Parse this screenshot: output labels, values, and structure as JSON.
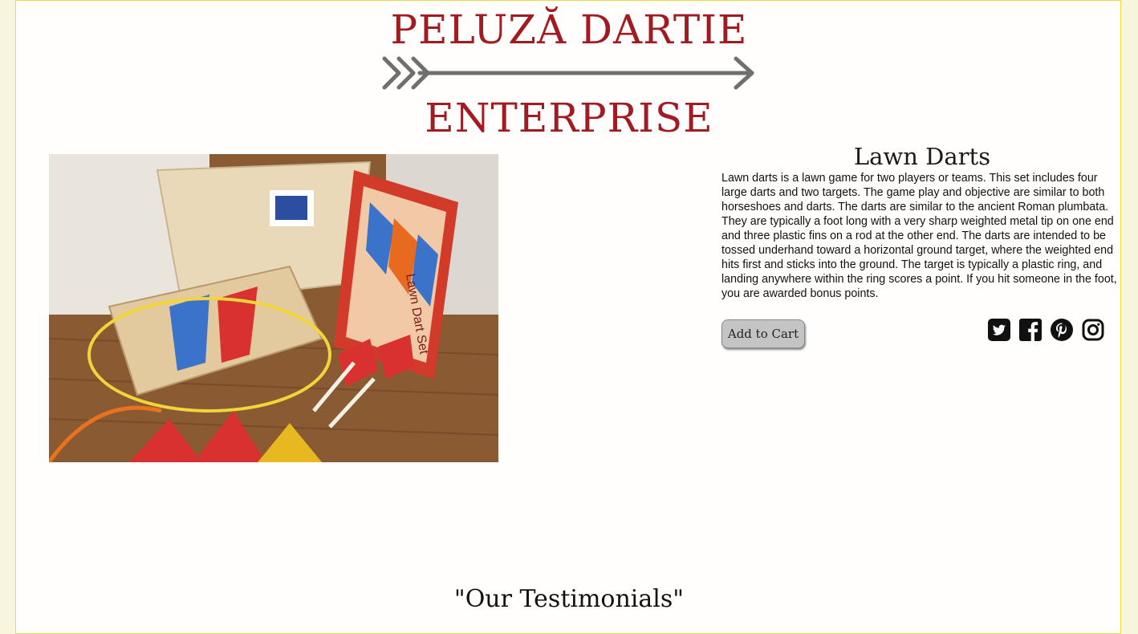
{
  "header": {
    "brand_line1": "PELUZĂ DARTIE",
    "brand_line2": "ENTERPRISE",
    "arrow_icon": "arrow-right-icon",
    "brand_color": "#a01c22"
  },
  "product": {
    "title": "Lawn Darts",
    "description": "Lawn darts is a lawn game for two players or teams. This set includes four large darts and two targets. The game play and objective are similar to both horseshoes and darts. The darts are similar to the ancient Roman plumbata. They are typically a foot long with a very sharp weighted metal tip on one end and three plastic fins on a rod at the other end. The darts are intended to be tossed underhand toward a horizontal ground target, where the weighted end hits first and sticks into the ground. The target is typically a plastic ring, and landing anywhere within the ring scores a point. If you hit someone in the foot, you are awarded bonus points.",
    "add_to_cart_label": "Add to Cart",
    "image_box_text": "Lawn Dart Set",
    "social_icons": [
      "twitter-icon",
      "facebook-icon",
      "pinterest-icon",
      "instagram-icon"
    ]
  },
  "testimonials": {
    "title": "\"Our Testimonials\""
  }
}
